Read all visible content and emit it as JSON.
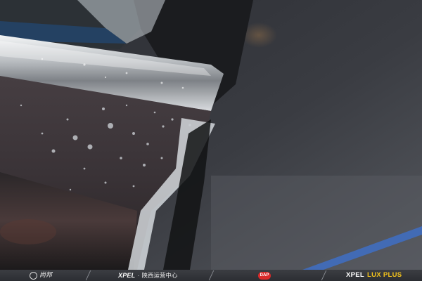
{
  "photo": {
    "subject": "black car body panel with chrome trim and protective film, water droplets",
    "colors": {
      "background": "#2e3036",
      "paint": "#3a3236",
      "chrome": "#cfd3d6",
      "film": "#e5ebef",
      "floor_line": "#3f6fc4"
    }
  },
  "footer": {
    "logo_a_text": "尚邦",
    "logo_b_brand": "XPEL",
    "logo_b_separator": "·",
    "logo_b_text": "陕西运营中心",
    "logo_c_text": "DAP",
    "logo_d_brand": "XPEL",
    "logo_d_sub": "LUX PLUS"
  }
}
